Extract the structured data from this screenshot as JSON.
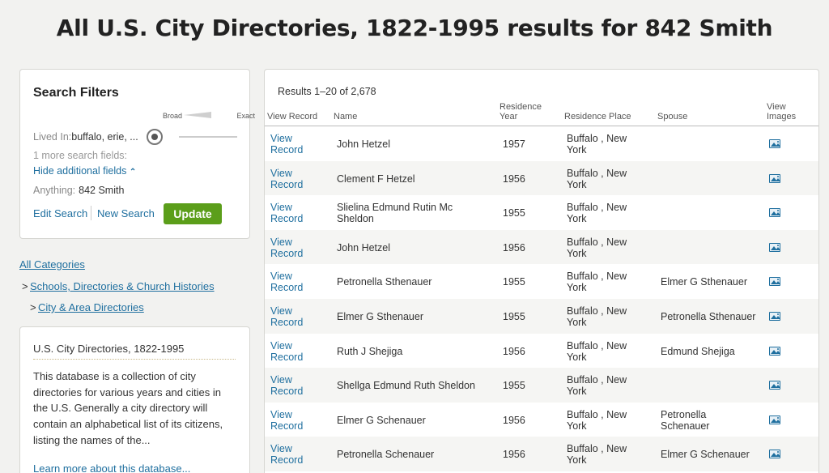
{
  "page": {
    "title": "All U.S. City Directories, 1822-1995 results for 842 Smith"
  },
  "filters": {
    "heading": "Search Filters",
    "slider_broad": "Broad",
    "slider_exact": "Exact",
    "lived_label": "Lived In:",
    "lived_value": "buffalo, erie, ...",
    "more_fields": "1 more search fields:",
    "hide_fields": "Hide additional fields",
    "anything_label": "Anything:",
    "anything_value": "842 Smith",
    "edit_search": "Edit Search",
    "new_search": "New Search",
    "update": "Update"
  },
  "categories": {
    "all": "All Categories",
    "prefix": ">",
    "level1": "Schools, Directories & Church Histories",
    "level2": "City & Area Directories"
  },
  "about": {
    "title": "U.S. City Directories, 1822-1995",
    "description": "This database is a collection of city directories for various years and cities in the U.S. Generally a city directory will contain an alphabetical list of its citizens, listing the names of the...",
    "learn_more": "Learn more about this database..."
  },
  "results": {
    "count": "Results 1–20 of 2,678",
    "columns": {
      "view_record": "View Record",
      "name": "Name",
      "year_line1": "Residence",
      "year_line2": "Year",
      "place": "Residence Place",
      "spouse": "Spouse",
      "images_line1": "View",
      "images_line2": "Images"
    },
    "rows": [
      {
        "link1": "View",
        "link2": "Record",
        "name1": "John Hetzel",
        "name2": "",
        "year": "1957",
        "place1": "Buffalo , New",
        "place2": "York",
        "spouse1": "",
        "spouse2": ""
      },
      {
        "link1": "View",
        "link2": "Record",
        "name1": "Clement F Hetzel",
        "name2": "",
        "year": "1956",
        "place1": "Buffalo , New",
        "place2": "York",
        "spouse1": "",
        "spouse2": ""
      },
      {
        "link1": "View",
        "link2": "Record",
        "name1": "Slielina Edmund Rutin Mc",
        "name2": "Sheldon",
        "year": "1955",
        "place1": "Buffalo , New",
        "place2": "York",
        "spouse1": "",
        "spouse2": ""
      },
      {
        "link1": "View",
        "link2": "Record",
        "name1": "John Hetzel",
        "name2": "",
        "year": "1956",
        "place1": "Buffalo , New",
        "place2": "York",
        "spouse1": "",
        "spouse2": ""
      },
      {
        "link1": "View",
        "link2": "Record",
        "name1": "Petronella Sthenauer",
        "name2": "",
        "year": "1955",
        "place1": "Buffalo , New",
        "place2": "York",
        "spouse1": "Elmer G Sthenauer",
        "spouse2": ""
      },
      {
        "link1": "View",
        "link2": "Record",
        "name1": "Elmer G Sthenauer",
        "name2": "",
        "year": "1955",
        "place1": "Buffalo , New",
        "place2": "York",
        "spouse1": "Petronella Sthenauer",
        "spouse2": ""
      },
      {
        "link1": "View",
        "link2": "Record",
        "name1": "Ruth J Shejiga",
        "name2": "",
        "year": "1956",
        "place1": "Buffalo , New",
        "place2": "York",
        "spouse1": "Edmund Shejiga",
        "spouse2": ""
      },
      {
        "link1": "View",
        "link2": "Record",
        "name1": "Shellga Edmund Ruth Sheldon",
        "name2": "",
        "year": "1955",
        "place1": "Buffalo , New",
        "place2": "York",
        "spouse1": "",
        "spouse2": ""
      },
      {
        "link1": "View",
        "link2": "Record",
        "name1": "Elmer G Schenauer",
        "name2": "",
        "year": "1956",
        "place1": "Buffalo , New",
        "place2": "York",
        "spouse1": "Petronella",
        "spouse2": "Schenauer"
      },
      {
        "link1": "View",
        "link2": "Record",
        "name1": "Petronella Schenauer",
        "name2": "",
        "year": "1956",
        "place1": "Buffalo , New",
        "place2": "York",
        "spouse1": "Elmer G Schenauer",
        "spouse2": ""
      }
    ]
  }
}
